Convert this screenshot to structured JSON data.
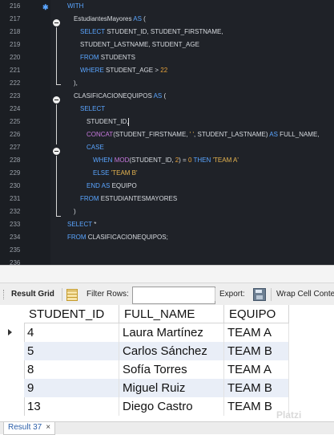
{
  "editor": {
    "lines": [
      {
        "num": "216",
        "tokens": [
          {
            "t": "WITH",
            "c": "kw"
          }
        ],
        "indent": 84
      },
      {
        "num": "217",
        "tokens": [
          {
            "t": "EstudiantesMayores ",
            "c": "id"
          },
          {
            "t": "AS",
            "c": "kw"
          },
          {
            "t": " (",
            "c": "id"
          }
        ],
        "indent": 92
      },
      {
        "num": "218",
        "tokens": [
          {
            "t": "SELECT",
            "c": "kw"
          },
          {
            "t": " STUDENT_ID, STUDENT_FIRSTNAME,",
            "c": "id"
          }
        ],
        "indent": 100
      },
      {
        "num": "219",
        "tokens": [
          {
            "t": "STUDENT_LASTNAME, STUDENT_AGE",
            "c": "id"
          }
        ],
        "indent": 100
      },
      {
        "num": "220",
        "tokens": [
          {
            "t": "FROM",
            "c": "kw"
          },
          {
            "t": " STUDENTS",
            "c": "id"
          }
        ],
        "indent": 100
      },
      {
        "num": "221",
        "tokens": [
          {
            "t": "WHERE",
            "c": "kw"
          },
          {
            "t": " STUDENT_AGE > ",
            "c": "id"
          },
          {
            "t": "22",
            "c": "num"
          }
        ],
        "indent": 100
      },
      {
        "num": "222",
        "tokens": [
          {
            "t": "),",
            "c": "id"
          }
        ],
        "indent": 92
      },
      {
        "num": "223",
        "tokens": [
          {
            "t": "CLASIFICACIONEQUIPOS ",
            "c": "id"
          },
          {
            "t": "AS",
            "c": "kw"
          },
          {
            "t": " (",
            "c": "id"
          }
        ],
        "indent": 92
      },
      {
        "num": "224",
        "tokens": [
          {
            "t": "SELECT",
            "c": "kw"
          }
        ],
        "indent": 100
      },
      {
        "num": "225",
        "tokens": [
          {
            "t": "STUDENT_ID,",
            "c": "id"
          }
        ],
        "cursor": true,
        "indent": 108
      },
      {
        "num": "226",
        "tokens": [
          {
            "t": "CONCAT",
            "c": "fn"
          },
          {
            "t": "(STUDENT_FIRSTNAME, ",
            "c": "id"
          },
          {
            "t": "' '",
            "c": "str"
          },
          {
            "t": ", STUDENT_LASTNAME) ",
            "c": "id"
          },
          {
            "t": "AS",
            "c": "kw"
          },
          {
            "t": " FULL_NAME,",
            "c": "id"
          }
        ],
        "indent": 108
      },
      {
        "num": "227",
        "tokens": [
          {
            "t": "CASE",
            "c": "kw"
          }
        ],
        "indent": 108
      },
      {
        "num": "228",
        "tokens": [
          {
            "t": "WHEN",
            "c": "kw"
          },
          {
            "t": " ",
            "c": "id"
          },
          {
            "t": "MOD",
            "c": "fn"
          },
          {
            "t": "(STUDENT_ID, ",
            "c": "id"
          },
          {
            "t": "2",
            "c": "num"
          },
          {
            "t": ") = ",
            "c": "id"
          },
          {
            "t": "0",
            "c": "num"
          },
          {
            "t": " ",
            "c": "id"
          },
          {
            "t": "THEN",
            "c": "kw"
          },
          {
            "t": " ",
            "c": "id"
          },
          {
            "t": "'TEAM A'",
            "c": "str"
          }
        ],
        "indent": 116
      },
      {
        "num": "229",
        "tokens": [
          {
            "t": "ELSE",
            "c": "kw"
          },
          {
            "t": " ",
            "c": "id"
          },
          {
            "t": "'TEAM B'",
            "c": "str"
          }
        ],
        "indent": 116
      },
      {
        "num": "230",
        "tokens": [
          {
            "t": "END",
            "c": "kw"
          },
          {
            "t": " ",
            "c": "id"
          },
          {
            "t": "AS",
            "c": "kw"
          },
          {
            "t": " EQUIPO",
            "c": "id"
          }
        ],
        "indent": 108
      },
      {
        "num": "231",
        "tokens": [
          {
            "t": "FROM",
            "c": "kw"
          },
          {
            "t": " ESTUDIANTESMAYORES",
            "c": "id"
          }
        ],
        "indent": 100
      },
      {
        "num": "232",
        "tokens": [
          {
            "t": ")",
            "c": "id"
          }
        ],
        "indent": 92
      },
      {
        "num": "233",
        "tokens": [
          {
            "t": "SELECT",
            "c": "kw"
          },
          {
            "t": " *",
            "c": "id"
          }
        ],
        "indent": 84
      },
      {
        "num": "234",
        "tokens": [
          {
            "t": "FROM",
            "c": "kw"
          },
          {
            "t": " CLASIFICACIONEQUIPOS;",
            "c": "id"
          }
        ],
        "indent": 84
      },
      {
        "num": "235",
        "tokens": [],
        "indent": 84
      },
      {
        "num": "236",
        "tokens": [],
        "indent": 84
      }
    ],
    "colors": {
      "keyword": "#5aa5ff",
      "function": "#c678dd",
      "string": "#e6b450",
      "number": "#e6a23c",
      "text": "#d7dbe0",
      "background": "#1f2228"
    }
  },
  "toolbar": {
    "result_grid_label": "Result Grid",
    "filter_rows_label": "Filter Rows:",
    "filter_rows_value": "",
    "export_label": "Export:",
    "wrap_label": "Wrap Cell Conte"
  },
  "grid": {
    "columns": [
      "STUDENT_ID",
      "FULL_NAME",
      "EQUIPO"
    ],
    "rows": [
      [
        "4",
        "Laura Martínez",
        "TEAM A"
      ],
      [
        "5",
        "Carlos Sánchez",
        "TEAM B"
      ],
      [
        "8",
        "Sofía Torres",
        "TEAM A"
      ],
      [
        "9",
        "Miguel Ruiz",
        "TEAM B"
      ],
      [
        "13",
        "Diego Castro",
        "TEAM B"
      ]
    ]
  },
  "tabs": {
    "result_tab_label": "Result 37",
    "close_glyph": "×"
  },
  "watermark": "Platzi"
}
